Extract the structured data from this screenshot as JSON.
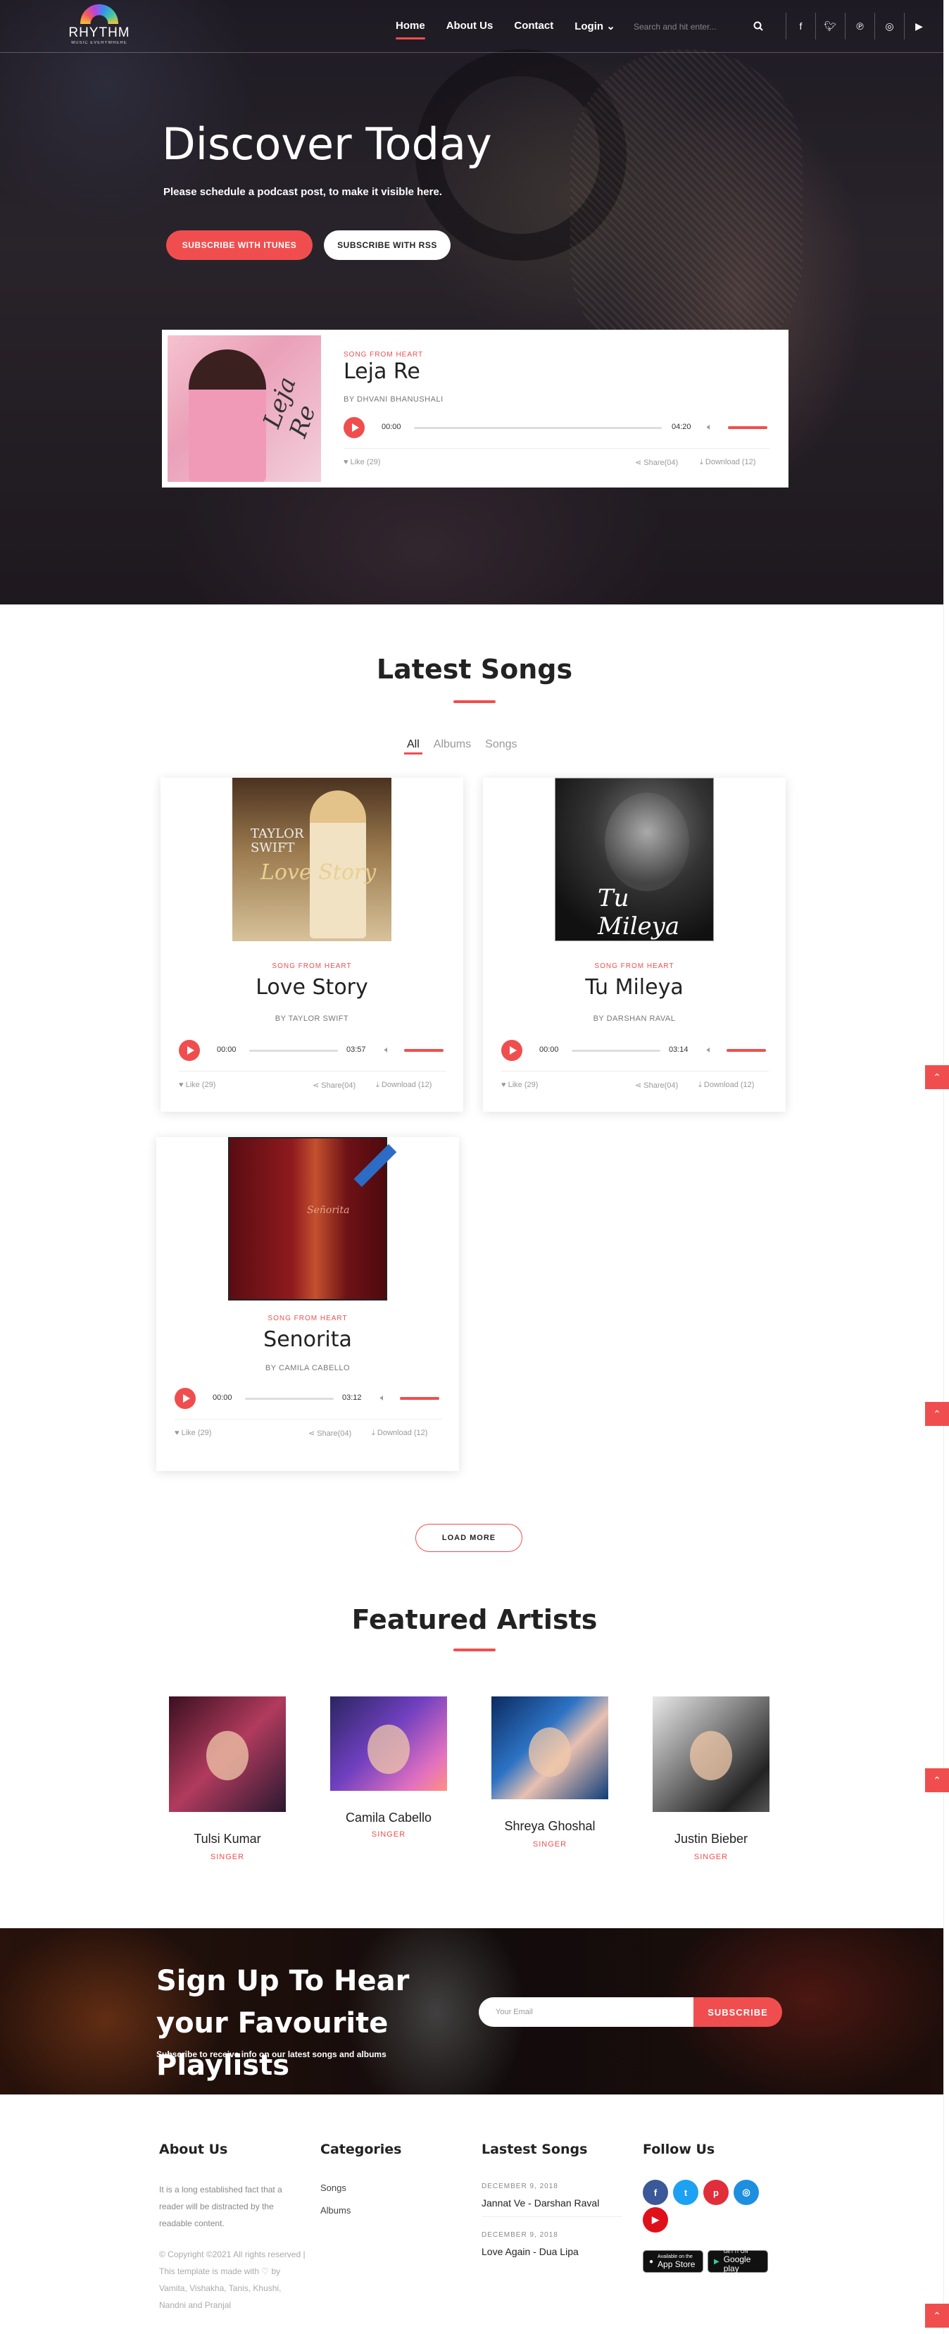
{
  "nav": {
    "logo_text": "RHYTHM",
    "logo_tagline": "MUSIC EVERYWHERE",
    "links": [
      {
        "label": "Home",
        "active": true
      },
      {
        "label": "About Us",
        "active": false
      },
      {
        "label": "Contact",
        "active": false
      },
      {
        "label": "Login",
        "active": false
      }
    ],
    "search_placeholder": "Search and hit enter...",
    "social_icons": [
      "facebook-icon",
      "twitter-icon",
      "pinterest-icon",
      "instagram-icon",
      "youtube-icon"
    ]
  },
  "hero": {
    "title": "Discover Today",
    "subtitle": "Please schedule a podcast post, to make it visible here.",
    "btn_itunes": "SUBSCRIBE WITH ITUNES",
    "btn_rss": "SUBSCRIBE WITH RSS",
    "featured": {
      "label": "SONG FROM HEART",
      "title": "Leja Re",
      "artist": "BY DHVANI BHANUSHALI",
      "current_time": "00:00",
      "duration": "04:20",
      "cover_text": "Leja Re",
      "likes": "Like (29)",
      "shares": "Share(04)",
      "downloads": "Download (12)"
    }
  },
  "latest": {
    "title": "Latest Songs",
    "filters": [
      "All",
      "Albums",
      "Songs"
    ],
    "active_filter": "All",
    "songs": [
      {
        "label": "SONG FROM HEART",
        "title": "Love Story",
        "artist": "BY TAYLOR SWIFT",
        "current_time": "00:00",
        "duration": "03:57",
        "likes": "Like (29)",
        "shares": "Share(04)",
        "downloads": "Download (12)",
        "cover_line1": "TAYLOR",
        "cover_line2": "SWIFT",
        "cover_script": "Love Story"
      },
      {
        "label": "SONG FROM HEART",
        "title": "Tu Mileya",
        "artist": "BY DARSHAN RAVAL",
        "current_time": "00:00",
        "duration": "03:14",
        "likes": "Like (29)",
        "shares": "Share(04)",
        "downloads": "Download (12)",
        "cover_script": "Tu Mileya"
      },
      {
        "label": "SONG FROM HEART",
        "title": "Senorita",
        "artist": "BY CAMILA CABELLO",
        "current_time": "00:00",
        "duration": "03:12",
        "likes": "Like (29)",
        "shares": "Share(04)",
        "downloads": "Download (12)",
        "cover_script": "Señorita"
      }
    ],
    "load_more": "LOAD MORE"
  },
  "artists": {
    "title": "Featured Artists",
    "items": [
      {
        "name": "Tulsi Kumar",
        "role": "SINGER"
      },
      {
        "name": "Camila Cabello",
        "role": "SINGER"
      },
      {
        "name": "Shreya Ghoshal",
        "role": "SINGER"
      },
      {
        "name": "Justin Bieber",
        "role": "SINGER"
      }
    ]
  },
  "signup": {
    "title": "Sign Up To Hear your Favourite Playlists",
    "subtitle": "Subscribe to receive info on our latest songs and albums",
    "email_placeholder": "Your Email",
    "button": "SUBSCRIBE"
  },
  "footer": {
    "about": {
      "heading": "About Us",
      "text": "It is a long established fact that a reader will be distracted by the readable content.",
      "copyright": "© Copyright ©2021 All rights reserved | This template is made with ♡ by Vamita, Vishakha, Tanis, Khushi, Nandni and Pranjal"
    },
    "categories": {
      "heading": "Categories",
      "links": [
        "Songs",
        "Albums"
      ]
    },
    "latest": {
      "heading": "Lastest Songs",
      "items": [
        {
          "date": "DECEMBER 9, 2018",
          "title": "Jannat Ve - Darshan Raval"
        },
        {
          "date": "DECEMBER 9, 2018",
          "title": "Love Again - Dua Lipa"
        }
      ]
    },
    "follow": {
      "heading": "Follow Us",
      "icons": [
        "facebook-icon",
        "twitter-icon",
        "pinterest-icon",
        "instagram-icon",
        "youtube-icon"
      ],
      "app_store": {
        "line1": "Available on the",
        "line2": "App Store"
      },
      "google_play": {
        "line1": "GET IT ON",
        "line2": "Google play"
      }
    }
  },
  "colors": {
    "accent": "#f04e4e",
    "facebook": "#3b5998",
    "twitter": "#1da1f2",
    "pinterest": "#e02e3a",
    "instagram": "#1d8fe0",
    "youtube": "#e0101b"
  }
}
